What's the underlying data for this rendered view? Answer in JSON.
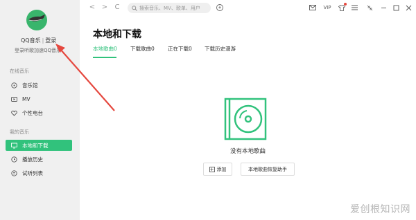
{
  "sidebar": {
    "login_name": "QQ音乐",
    "login_sep": "|",
    "login_link": "登录",
    "login_hint": "登录听歌加速QQ音乐",
    "section_online": "在线音乐",
    "section_mine": "我的音乐",
    "online_items": [
      {
        "label": "音乐馆",
        "icon": "disc-icon"
      },
      {
        "label": "MV",
        "icon": "video-icon"
      },
      {
        "label": "个性电台",
        "icon": "heart-radio-icon"
      }
    ],
    "mine_items": [
      {
        "label": "本地和下载",
        "icon": "monitor-icon",
        "active": true
      },
      {
        "label": "播放历史",
        "icon": "clock-icon"
      },
      {
        "label": "试听列表",
        "icon": "list-icon"
      }
    ]
  },
  "topbar": {
    "back": "<",
    "forward": ">",
    "refresh": "C",
    "search_placeholder": "搜索音乐、MV、歌单、用户",
    "vip": "VIP",
    "icons": [
      "mail-icon",
      "vip-icon",
      "shirt-icon",
      "menu-icon",
      "mini-mode-icon",
      "minimize-icon",
      "maximize-icon",
      "close-icon"
    ]
  },
  "main": {
    "title": "本地和下载",
    "tabs": [
      {
        "label": "本地歌曲0",
        "active": true
      },
      {
        "label": "下载歌曲0"
      },
      {
        "label": "正在下载0"
      },
      {
        "label": "下载历史漫游"
      }
    ],
    "empty_text": "没有本地歌曲",
    "add_button": "添加",
    "restore_button": "本地歌曲恢复助手"
  },
  "watermark": "爱创根知识网",
  "colors": {
    "accent": "#31c27c",
    "arrow": "#e5483f"
  }
}
